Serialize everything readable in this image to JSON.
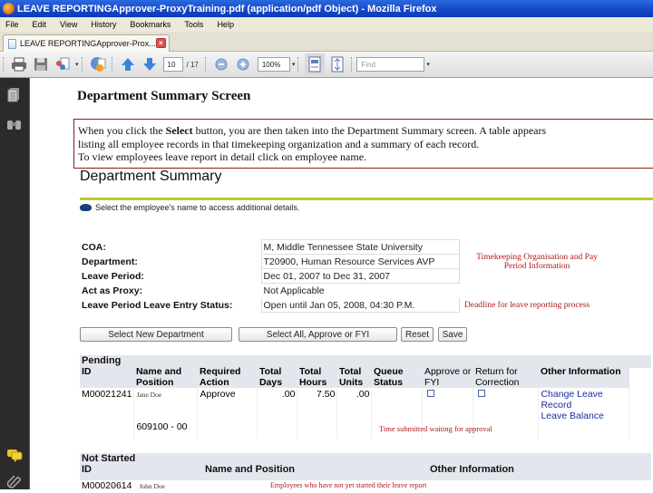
{
  "window": {
    "title": "LEAVE REPORTINGApprover-ProxyTraining.pdf (application/pdf Object) - Mozilla Firefox"
  },
  "menu": [
    "File",
    "Edit",
    "View",
    "History",
    "Bookmarks",
    "Tools",
    "Help"
  ],
  "tab": {
    "label": "LEAVE REPORTINGApprover-Prox..."
  },
  "pdf_toolbar": {
    "page_current": "10",
    "page_total": "/ 17",
    "zoom_value": "100%",
    "find_placeholder": "Find"
  },
  "document": {
    "heading": "Department Summary Screen",
    "callout": {
      "line1_pre": "When you click the ",
      "line1_bold": "Select",
      "line1_post": " button, you are then taken into the Department Summary screen.  A table appears",
      "line2": "listing all employee records in that timekeeping organization and a summary of each record.",
      "line3": "To view employees leave report in detail click on employee name."
    }
  },
  "dept_summary": {
    "title": "Department Summary",
    "hint": "Select the employee's name to access additional details.",
    "info": [
      {
        "label": "COA:",
        "value": "M, Middle Tennessee State University"
      },
      {
        "label": "Department:",
        "value": "T20900, Human Resource Services AVP"
      },
      {
        "label": "Leave Period:",
        "value": "Dec 01, 2007 to Dec 31, 2007"
      },
      {
        "label": "Act as Proxy:",
        "value": "Not Applicable"
      },
      {
        "label": "Leave Period Leave Entry Status:",
        "value": "Open until Jan 05, 2008, 04:30 P.M."
      }
    ],
    "notes": {
      "timekeeping": "Timekeeping Organisation and Pay Period Information",
      "deadline": "Deadline for leave reporting process",
      "submitted": "Time submitted waiting for approval",
      "not_started": "Employees who have not yet started their leave report"
    },
    "buttons": {
      "select_dept": "Select New Department",
      "select_all": "Select All, Approve or FYI",
      "reset": "Reset",
      "save": "Save"
    },
    "pending": {
      "title": "Pending",
      "headers": [
        "ID",
        "Name and Position",
        "Required Action",
        "Total Days",
        "Total Hours",
        "Total Units",
        "Queue Status",
        "Approve or FYI",
        "Return for Correction",
        "Other Information"
      ],
      "rows": [
        {
          "id": "M00021241",
          "name": "Jane Doe",
          "position": "609100 - 00",
          "action": "Approve",
          "days": ".00",
          "hours": "7.50",
          "units": ".00",
          "links": [
            "Change Leave Record",
            "Leave Balance"
          ]
        }
      ]
    },
    "not_started": {
      "title": "Not Started",
      "headers": [
        "ID",
        "Name and Position",
        "Other Information"
      ],
      "rows": [
        {
          "id": "M00020614",
          "name": "John Doe"
        }
      ]
    }
  }
}
